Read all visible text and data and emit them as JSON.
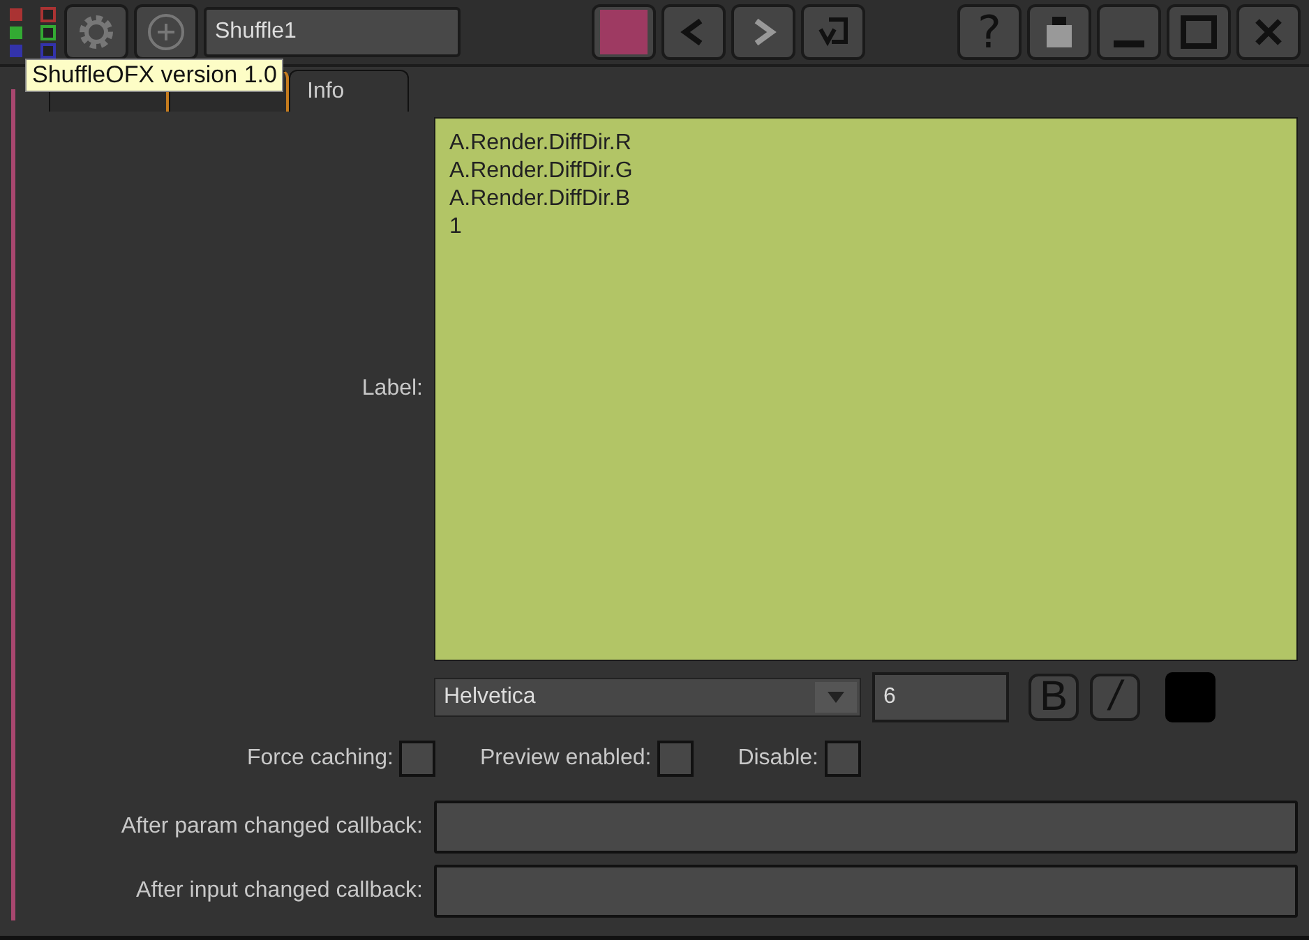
{
  "toolbar": {
    "node_name": "Shuffle1",
    "buttons": [
      {
        "kind": "back",
        "disabled": false
      },
      {
        "kind": "forward",
        "disabled": true
      },
      {
        "kind": "undo",
        "disabled": false
      }
    ],
    "window_buttons": [
      {
        "label": "?",
        "kind": "help"
      },
      {
        "kind": "float"
      },
      {
        "kind": "minimize"
      },
      {
        "kind": "maximize"
      },
      {
        "kind": "close"
      }
    ]
  },
  "tooltip": "ShuffleOFX version 1.0",
  "tabs": [
    {
      "selected": false
    },
    {
      "selected": false
    },
    {
      "label": "Info",
      "selected": true
    }
  ],
  "label_field": {
    "label": "Label:",
    "lines": [
      "A.Render.DiffDir.R",
      "A.Render.DiffDir.G",
      "A.Render.DiffDir.B",
      "1"
    ]
  },
  "font": {
    "family": "Helvetica",
    "size": "6",
    "bold_label": "B",
    "italic_label": "/"
  },
  "checkboxes": [
    {
      "label": "Force caching:",
      "checked": false
    },
    {
      "label": "Preview enabled:",
      "checked": false
    },
    {
      "label": "Disable:",
      "checked": false
    }
  ],
  "callbacks": [
    {
      "label": "After param changed callback:"
    },
    {
      "label": "After input changed callback:"
    }
  ]
}
